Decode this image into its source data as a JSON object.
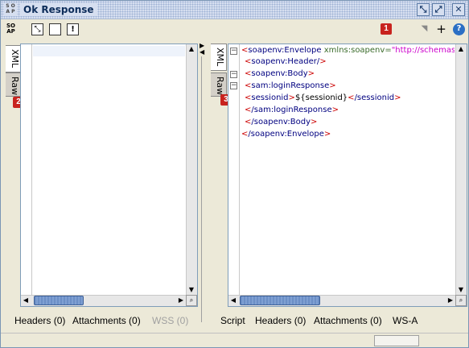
{
  "window": {
    "title": "Ok Response",
    "soap_icon": "SOAP"
  },
  "title_buttons": [
    "restore-icon",
    "detach-icon",
    "close-icon"
  ],
  "toolbar": {
    "badge_1": "1"
  },
  "left_panel": {
    "tabs": [
      "XML",
      "Raw"
    ],
    "badge": "2",
    "bottom_tabs": {
      "headers": "Headers (0)",
      "attachments": "Attachments (0)",
      "wss": "WSS (0)"
    }
  },
  "right_panel": {
    "tabs": [
      "XML",
      "Raw"
    ],
    "badge": "3",
    "xml": {
      "l1_tag": "soapenv:Envelope",
      "l1_attr": "xmlns:soapenv=",
      "l1_val": "\"http://schemas.xn",
      "l2": "soapenv:Header/",
      "l3": "soapenv:Body",
      "l4": "sam:loginResponse",
      "l5_tag": "sessionid",
      "l5_text": "${sessionid}",
      "l5_close": "/sessionid",
      "l6": "/sam:loginResponse",
      "l7": "/soapenv:Body",
      "l8": "/soapenv:Envelope"
    },
    "bottom_tabs": {
      "script": "Script",
      "headers": "Headers (0)",
      "attachments": "Attachments (0)",
      "wsa": "WS-A"
    }
  },
  "colors": {
    "badge": "#c8231e",
    "scroll_thumb": "#6c8fc6",
    "title_text": "#0d2d5a"
  }
}
